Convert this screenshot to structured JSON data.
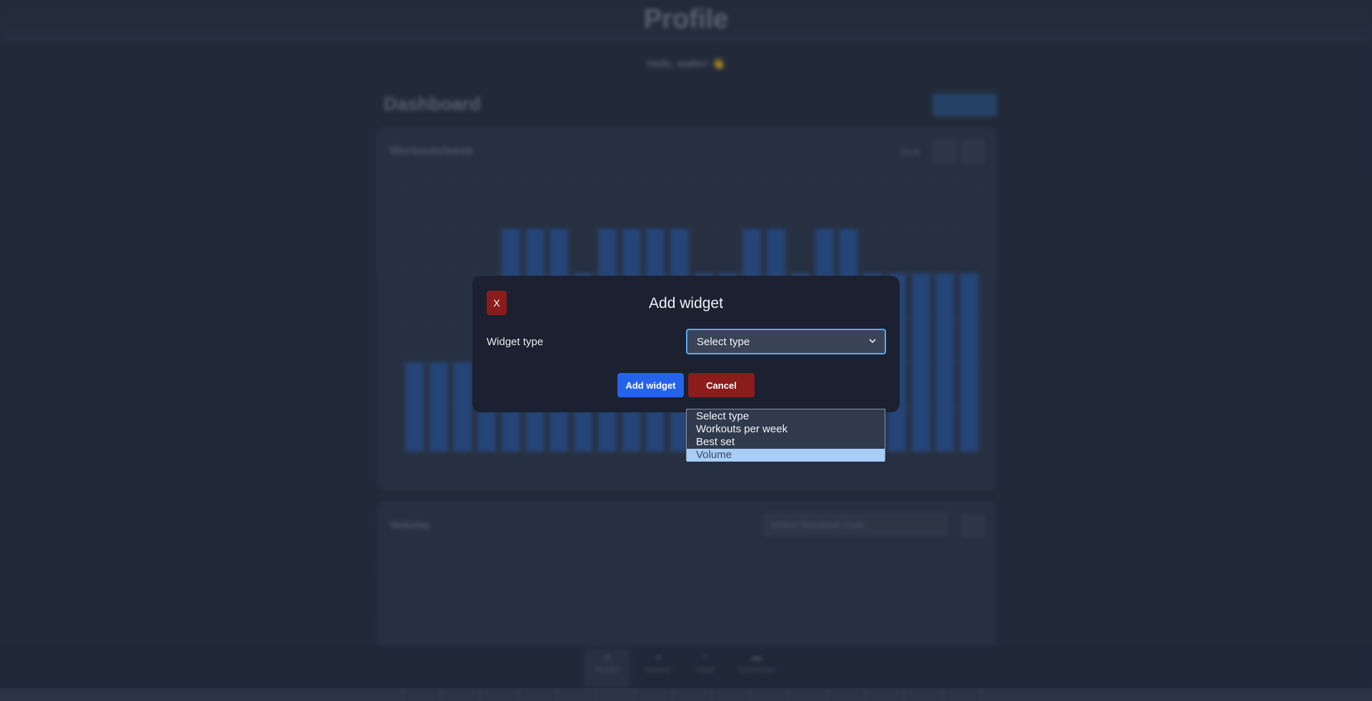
{
  "page": {
    "title": "Profile",
    "greeting": "Hello, walter! 👋"
  },
  "dashboard": {
    "title": "Dashboard"
  },
  "workouts_card": {
    "title": "Workouts/week",
    "goal_label": "Goal",
    "chart_data": {
      "type": "bar",
      "values": [
        2,
        2,
        2,
        2,
        5,
        5,
        5,
        4,
        5,
        5,
        5,
        5,
        4,
        4,
        5,
        5,
        4,
        5,
        5,
        4,
        4,
        4,
        4,
        4
      ]
    }
  },
  "volume_card": {
    "title": "Volume",
    "exercise_select": "Incline Dumbbell Curls"
  },
  "bottom_nav": {
    "items": [
      {
        "label": "Profile",
        "icon": "person-icon"
      },
      {
        "label": "History",
        "icon": "clock-icon"
      },
      {
        "label": "Start",
        "icon": "plus-icon"
      },
      {
        "label": "Exercises",
        "icon": "dumbbell-icon"
      }
    ]
  },
  "modal": {
    "close_label": "X",
    "title": "Add widget",
    "field_label": "Widget type",
    "select_value": "Select type",
    "add_button": "Add widget",
    "cancel_button": "Cancel"
  },
  "dropdown": {
    "options": [
      "Select type",
      "Workouts per week",
      "Best set",
      "Volume"
    ],
    "highlighted": "Volume"
  },
  "colors": {
    "accent_blue": "#2563eb",
    "danger_red": "#8b1c1c",
    "focus_ring": "#5aa7ee",
    "highlight": "#a8cdf6"
  }
}
